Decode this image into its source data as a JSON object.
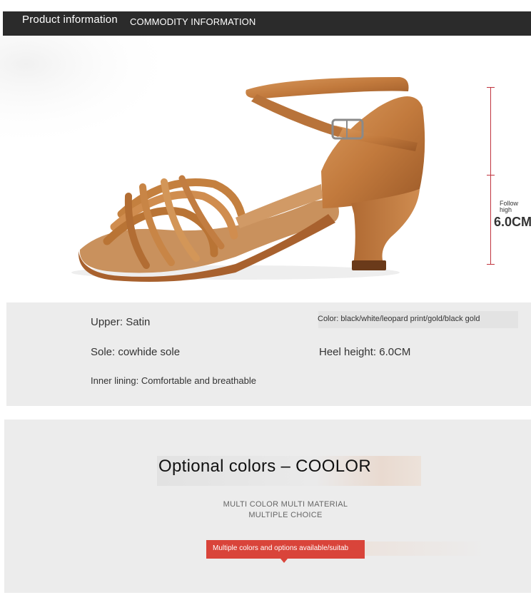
{
  "header": {
    "title": "Product information",
    "subtitle": "COMMODITY INFORMATION"
  },
  "product_image": {
    "height_label_line1": "Follow",
    "height_label_line2": "high",
    "heel_height_value": "6.0CM"
  },
  "specs": {
    "upper": "Upper: Satin",
    "color": "Color: black/white/leopard print/gold/black gold",
    "sole": "Sole: cowhide sole",
    "heel_height": "Heel height: 6.0CM",
    "inner_lining": "Inner lining: Comfortable and breathable"
  },
  "colors_section": {
    "title": "Optional colors – COOLOR",
    "subtitle_line1": "MULTI COLOR MULTI MATERIAL",
    "subtitle_line2": "MULTIPLE CHOICE",
    "banner_text": "Multiple colors and options available/suitab"
  },
  "theme": {
    "header_bg": "#2b2b2b",
    "panel_bg": "#ececec",
    "accent_red": "#d9443a",
    "measure_red": "#c0343e",
    "satin_tan": "#c8844a"
  }
}
